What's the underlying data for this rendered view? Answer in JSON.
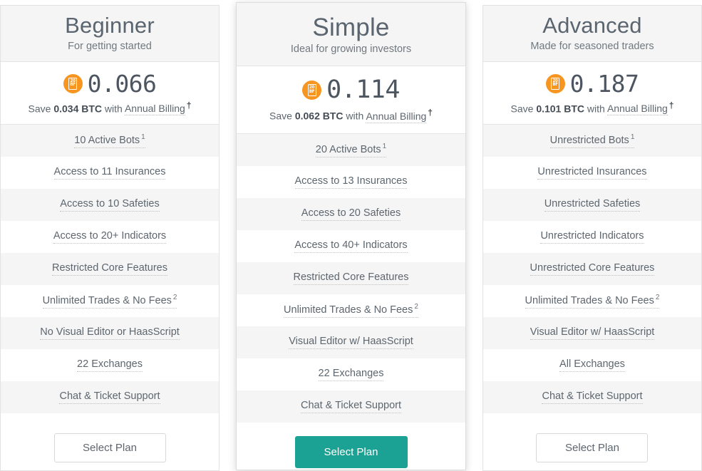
{
  "accent": {
    "btc_orange": "#f79521",
    "cta_teal": "#1ba294",
    "text_gray": "#5d666e",
    "row_shade": "#f5f5f5"
  },
  "currency_icon": {
    "name": "btc-coin-icon",
    "line1": "20",
    "line2": "BF"
  },
  "plans": [
    {
      "id": "beginner",
      "featured": false,
      "name": "Beginner",
      "tagline": "For getting started",
      "price": "0.066",
      "savings_prefix": "Save",
      "savings_amount": "0.034 BTC",
      "savings_middle": "with",
      "savings_billing": "Annual Billing",
      "savings_dagger": "†",
      "features": [
        {
          "label": "10 Active Bots",
          "sup": "1"
        },
        {
          "label": "Access to 11 Insurances",
          "sup": ""
        },
        {
          "label": "Access to 10 Safeties",
          "sup": ""
        },
        {
          "label": "Access to 20+ Indicators",
          "sup": ""
        },
        {
          "label": "Restricted Core Features",
          "sup": ""
        },
        {
          "label": "Unlimited Trades & No Fees",
          "sup": "2"
        },
        {
          "label": "No Visual Editor or HaasScript",
          "sup": ""
        },
        {
          "label": "22 Exchanges",
          "sup": ""
        },
        {
          "label": "Chat & Ticket Support",
          "sup": ""
        }
      ],
      "cta": "Select Plan"
    },
    {
      "id": "simple",
      "featured": true,
      "name": "Simple",
      "tagline": "Ideal for growing investors",
      "price": "0.114",
      "savings_prefix": "Save",
      "savings_amount": "0.062 BTC",
      "savings_middle": "with",
      "savings_billing": "Annual Billing",
      "savings_dagger": "†",
      "features": [
        {
          "label": "20 Active Bots",
          "sup": "1"
        },
        {
          "label": "Access to 13 Insurances",
          "sup": ""
        },
        {
          "label": "Access to 20 Safeties",
          "sup": ""
        },
        {
          "label": "Access to 40+ Indicators",
          "sup": ""
        },
        {
          "label": "Restricted Core Features",
          "sup": ""
        },
        {
          "label": "Unlimited Trades & No Fees",
          "sup": "2"
        },
        {
          "label": "Visual Editor w/ HaasScript",
          "sup": ""
        },
        {
          "label": "22 Exchanges",
          "sup": ""
        },
        {
          "label": "Chat & Ticket Support",
          "sup": ""
        }
      ],
      "cta": "Select Plan"
    },
    {
      "id": "advanced",
      "featured": false,
      "name": "Advanced",
      "tagline": "Made for seasoned traders",
      "price": "0.187",
      "savings_prefix": "Save",
      "savings_amount": "0.101 BTC",
      "savings_middle": "with",
      "savings_billing": "Annual Billing",
      "savings_dagger": "†",
      "features": [
        {
          "label": "Unrestricted Bots",
          "sup": "1"
        },
        {
          "label": "Unrestricted Insurances",
          "sup": ""
        },
        {
          "label": "Unrestricted Safeties",
          "sup": ""
        },
        {
          "label": "Unrestricted Indicators",
          "sup": ""
        },
        {
          "label": "Unrestricted Core Features",
          "sup": ""
        },
        {
          "label": "Unlimited Trades & No Fees",
          "sup": "2"
        },
        {
          "label": "Visual Editor w/ HaasScript",
          "sup": ""
        },
        {
          "label": "All Exchanges",
          "sup": ""
        },
        {
          "label": "Chat & Ticket Support",
          "sup": ""
        }
      ],
      "cta": "Select Plan"
    }
  ]
}
